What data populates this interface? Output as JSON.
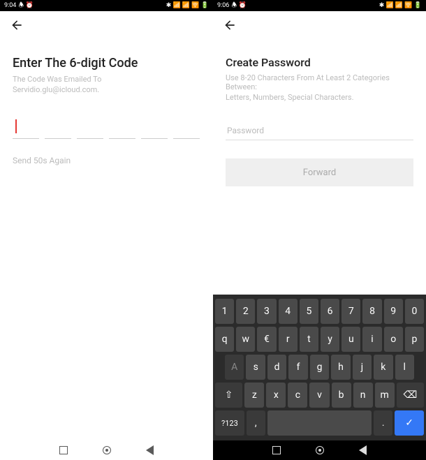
{
  "left": {
    "statusbar": {
      "time": "9:04",
      "icons_left": "🕭 ⏰",
      "icons_right": "✱ 📶 📶 🛜 🔋"
    },
    "title": "Enter The 6-digit Code",
    "sub1": "The Code Was Emailed To",
    "sub2": "Servidio.glu@icloud.com.",
    "resend": "Send 50s Again"
  },
  "right": {
    "statusbar": {
      "time": "9:06",
      "icons_left": "🕭 ⏰",
      "icons_right": "✱ 📶 📶 🛜 🔋"
    },
    "title": "Create Password",
    "sub1": "Use 8-20 Characters From At Least 2 Categories Between:",
    "sub2": "Letters, Numbers, Special Characters.",
    "placeholder": "Password",
    "forward": "Forward"
  },
  "keyboard": {
    "row1": [
      "1",
      "2",
      "3",
      "4",
      "5",
      "6",
      "7",
      "8",
      "9",
      "0"
    ],
    "row2": [
      "q",
      "w",
      "€",
      "r",
      "t",
      "y",
      "u",
      "i",
      "o",
      "p"
    ],
    "row3": [
      "A",
      "s",
      "d",
      "f",
      "g",
      "h",
      "j",
      "k",
      "l"
    ],
    "row4_shift": "⇧",
    "row4": [
      "z",
      "x",
      "c",
      "v",
      "b",
      "n",
      "m"
    ],
    "row4_del": "⌫",
    "row5_sym": "?123",
    "row5_comma": ",",
    "row5_period": ".",
    "row5_enter": "✓"
  }
}
